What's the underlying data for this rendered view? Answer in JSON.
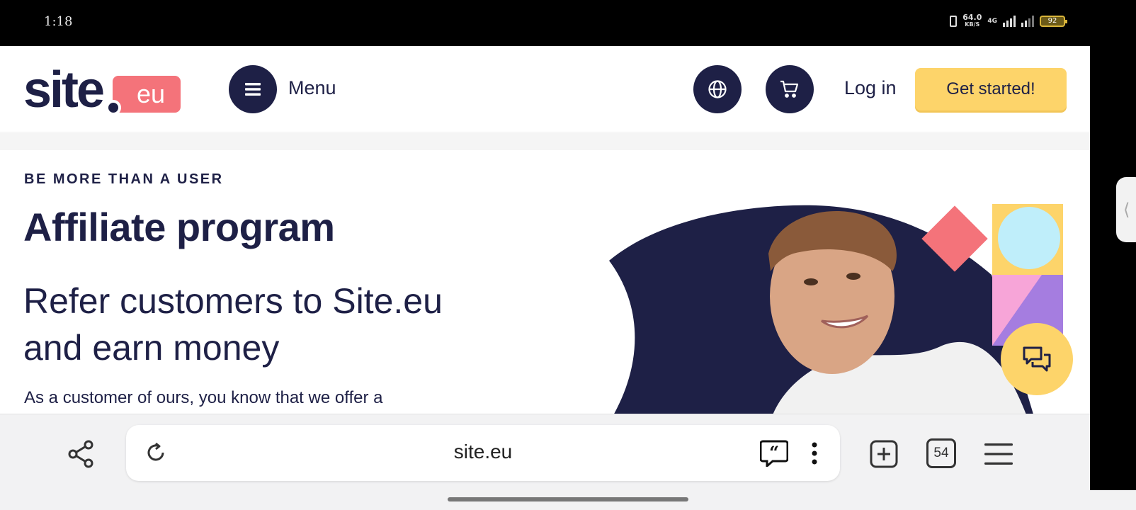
{
  "status_bar": {
    "time": "1:18",
    "net_speed": "64.0",
    "net_speed_unit": "KB/S",
    "network_type": "4G",
    "battery": "92"
  },
  "header": {
    "logo_main": "site",
    "logo_suffix": "eu",
    "menu_label": "Menu",
    "login_label": "Log in",
    "cta_label": "Get started!"
  },
  "hero": {
    "eyebrow": "BE MORE THAN A USER",
    "title": "Affiliate program",
    "subtitle": "Refer customers to Site.eu and earn money",
    "body": "As a customer of ours, you know that we offer a"
  },
  "toolbar": {
    "url": "site.eu",
    "tab_count": "54"
  },
  "colors": {
    "brand_navy": "#1e2046",
    "brand_coral": "#f4737a",
    "cta_yellow": "#fdd46a",
    "accent_blue": "#bfeefa",
    "accent_purple": "#a57de0",
    "accent_pink": "#f7a5d8"
  },
  "icons": {
    "menu": "hamburger-icon",
    "language": "globe-icon",
    "cart": "cart-icon",
    "chat": "chat-bubbles-icon",
    "share": "share-icon",
    "reload": "reload-icon",
    "quote": "quote-icon",
    "more": "more-vertical-icon",
    "new_tab": "plus-square-icon",
    "browser_menu": "hamburger-icon"
  }
}
